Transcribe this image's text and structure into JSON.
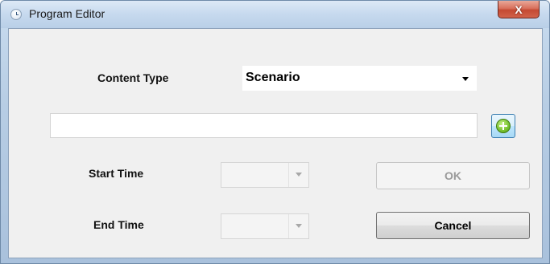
{
  "window": {
    "title": "Program Editor",
    "close_glyph": "X"
  },
  "form": {
    "content_type_label": "Content Type",
    "content_type_value": "Scenario",
    "name_input_value": "",
    "start_time_label": "Start Time",
    "start_time_value": "",
    "end_time_label": "End Time",
    "end_time_value": "",
    "add_icon": "plus-circle-icon"
  },
  "buttons": {
    "ok_label": "OK",
    "cancel_label": "Cancel"
  },
  "colors": {
    "title_bar": "#c6d9ee",
    "close_button": "#c44a33",
    "client_background": "#f0f0f0",
    "add_icon_green": "#7cc634"
  }
}
